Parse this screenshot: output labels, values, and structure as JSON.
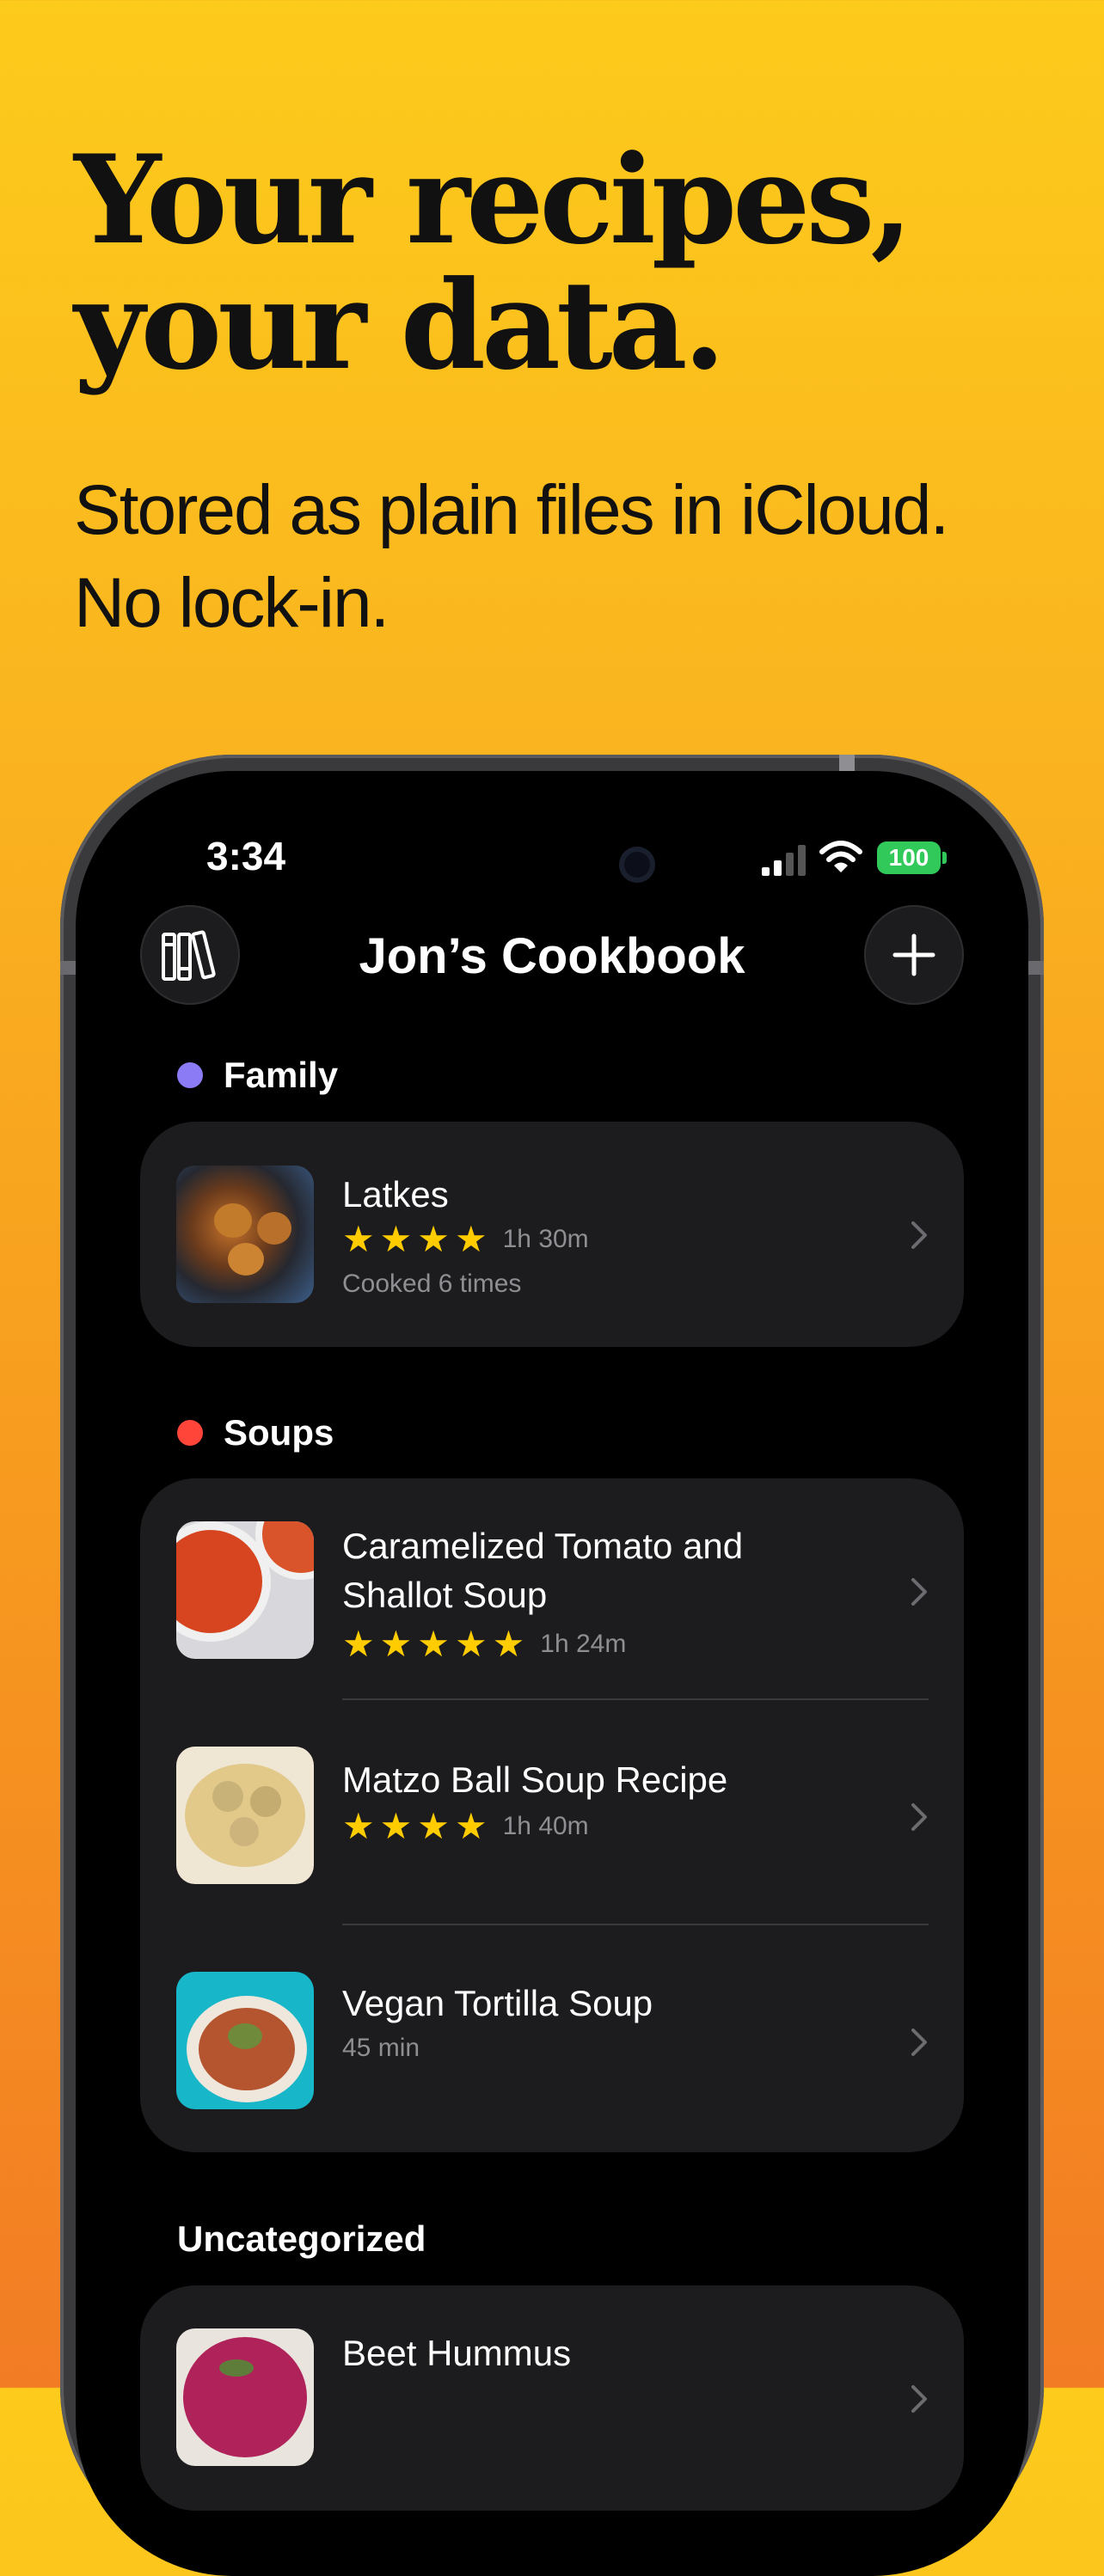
{
  "marketing": {
    "headline": "Your recipes,\nyour data.",
    "subhead": "Stored as plain files in iCloud.\nNo lock-in."
  },
  "status_bar": {
    "time": "3:34",
    "battery": "100"
  },
  "nav": {
    "title": "Jon’s Cookbook",
    "left_icon": "library-icon",
    "right_icon": "plus-icon"
  },
  "sections": [
    {
      "name": "Family",
      "color": "#8B7CF6",
      "recipes": [
        {
          "title": "Latkes",
          "rating": 4,
          "stars": "★★★★",
          "duration": "1h 30m",
          "subtitle": "Cooked 6 times"
        }
      ]
    },
    {
      "name": "Soups",
      "color": "#FF453A",
      "recipes": [
        {
          "title": "Caramelized Tomato and Shallot Soup",
          "rating": 5,
          "stars": "★★★★★",
          "duration": "1h 24m"
        },
        {
          "title": "Matzo Ball Soup Recipe",
          "rating": 4,
          "stars": "★★★★",
          "duration": "1h 40m"
        },
        {
          "title": "Vegan Tortilla Soup",
          "subtitle": "45 min"
        }
      ]
    },
    {
      "name": "Uncategorized",
      "recipes": [
        {
          "title": "Beet Hummus"
        }
      ]
    }
  ]
}
